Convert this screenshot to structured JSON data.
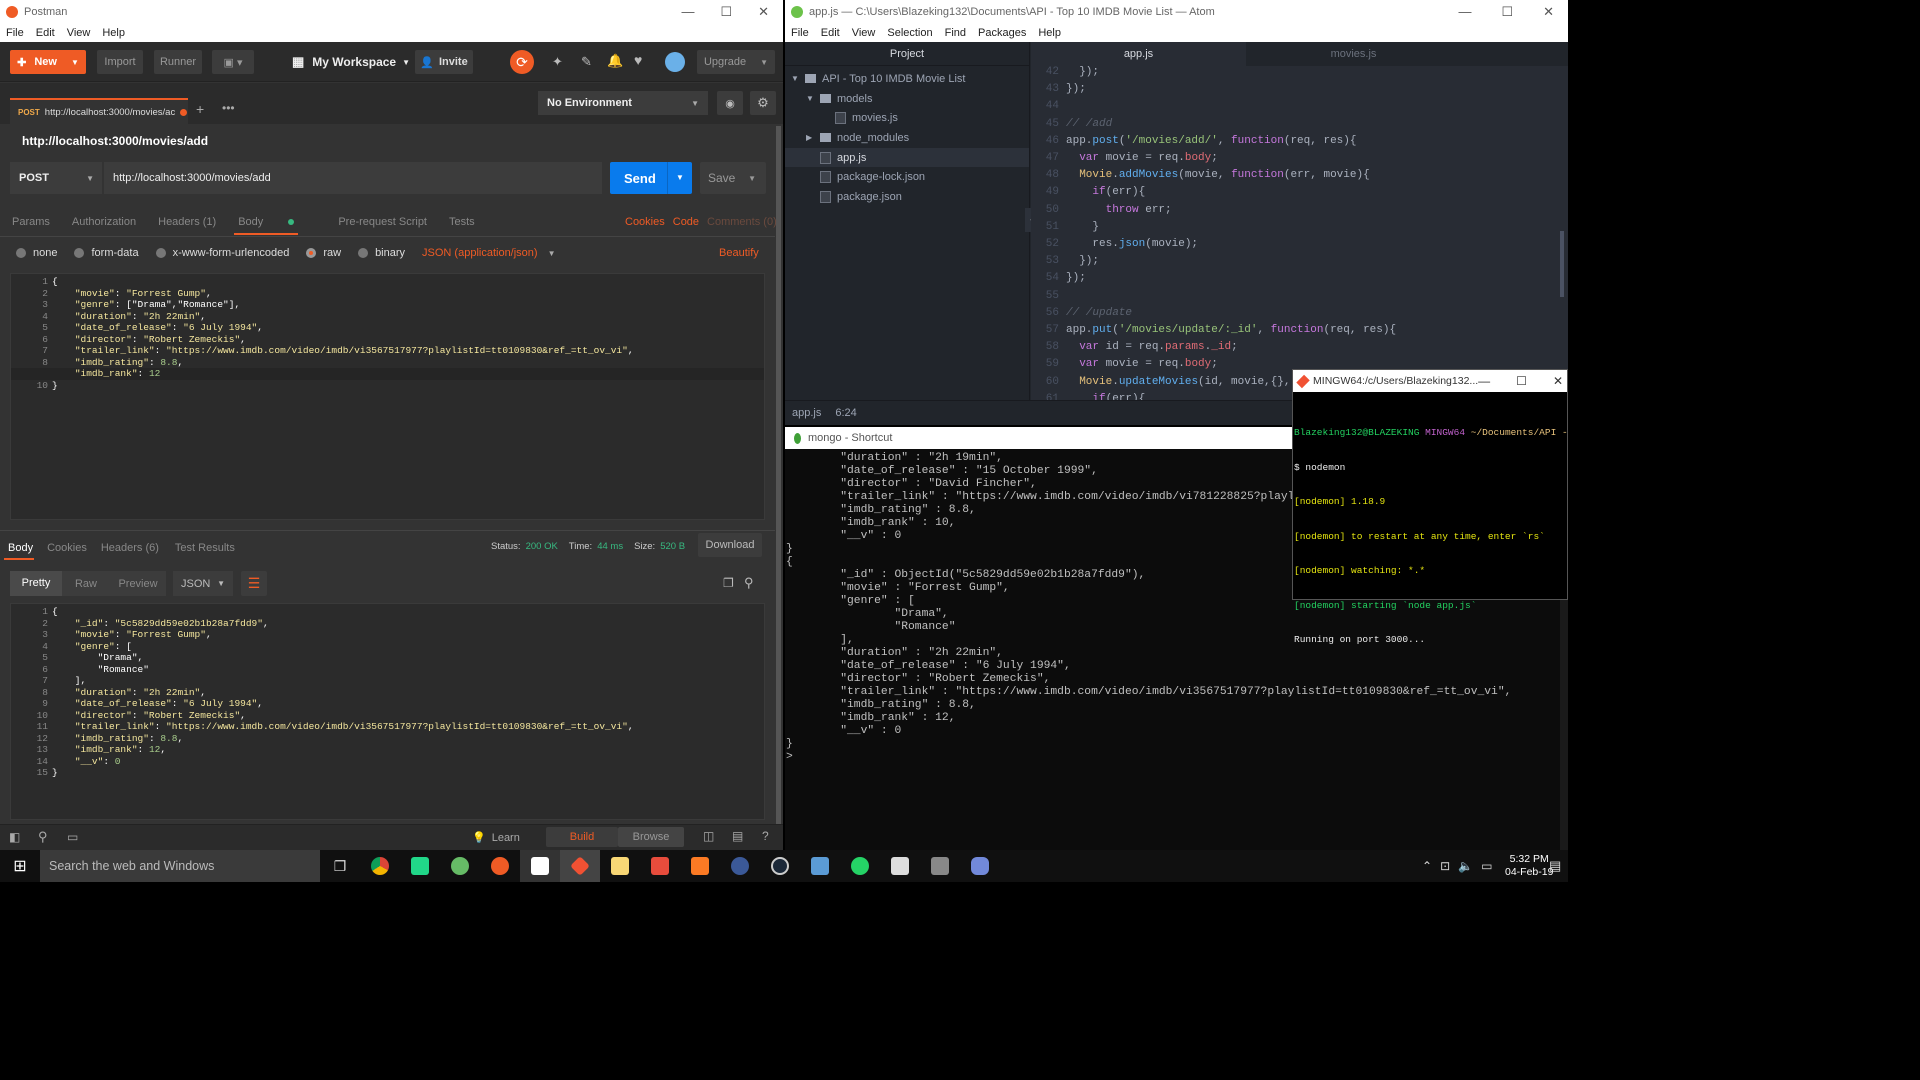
{
  "postman": {
    "title": "Postman",
    "menu": [
      "File",
      "Edit",
      "View",
      "Help"
    ],
    "toolbar": {
      "new": "New",
      "import": "Import",
      "runner": "Runner",
      "workspace": "My Workspace",
      "invite": "Invite",
      "upgrade": "Upgrade"
    },
    "tab": {
      "method": "POST",
      "url": "http://localhost:3000/movies/ac"
    },
    "environment": "No Environment",
    "request_title": "http://localhost:3000/movies/add",
    "method": "POST",
    "url": "http://localhost:3000/movies/add",
    "send": "Send",
    "save": "Save",
    "req_tabs": [
      "Params",
      "Authorization",
      "Headers (1)",
      "Body",
      "Pre-request Script",
      "Tests"
    ],
    "req_links": {
      "cookies": "Cookies",
      "code": "Code",
      "comments": "Comments (0)"
    },
    "body_types": [
      "none",
      "form-data",
      "x-www-form-urlencoded",
      "raw",
      "binary"
    ],
    "content_type": "JSON (application/json)",
    "beautify": "Beautify",
    "request_body": [
      "{",
      "    \"movie\": \"Forrest Gump\",",
      "    \"genre\": [\"Drama\",\"Romance\"],",
      "    \"duration\": \"2h 22min\",",
      "    \"date_of_release\": \"6 July 1994\",",
      "    \"director\": \"Robert Zemeckis\",",
      "    \"trailer_link\": \"https://www.imdb.com/video/imdb/vi3567517977?playlistId=tt0109830&ref_=tt_ov_vi\",",
      "    \"imdb_rating\": 8.8,",
      "    \"imdb_rank\": 12",
      "}"
    ],
    "resp_tabs": [
      "Body",
      "Cookies",
      "Headers (6)",
      "Test Results"
    ],
    "status": {
      "status_label": "Status:",
      "status": "200 OK",
      "time_label": "Time:",
      "time": "44 ms",
      "size_label": "Size:",
      "size": "520 B"
    },
    "download": "Download",
    "view_modes": [
      "Pretty",
      "Raw",
      "Preview"
    ],
    "format": "JSON",
    "response_body": [
      "{",
      "    \"_id\": \"5c5829dd59e02b1b28a7fdd9\",",
      "    \"movie\": \"Forrest Gump\",",
      "    \"genre\": [",
      "        \"Drama\",",
      "        \"Romance\"",
      "    ],",
      "    \"duration\": \"2h 22min\",",
      "    \"date_of_release\": \"6 July 1994\",",
      "    \"director\": \"Robert Zemeckis\",",
      "    \"trailer_link\": \"https://www.imdb.com/video/imdb/vi3567517977?playlistId=tt0109830&ref_=tt_ov_vi\",",
      "    \"imdb_rating\": 8.8,",
      "    \"imdb_rank\": 12,",
      "    \"__v\": 0",
      "}"
    ],
    "footer": {
      "learn": "Learn",
      "build": "Build",
      "browse": "Browse"
    }
  },
  "atom": {
    "title": "app.js — C:\\Users\\Blazeking132\\Documents\\API - Top 10 IMDB Movie List — Atom",
    "menu": [
      "File",
      "Edit",
      "View",
      "Selection",
      "Find",
      "Packages",
      "Help"
    ],
    "project_label": "Project",
    "tabs": [
      "app.js",
      "movies.js"
    ],
    "tree": [
      {
        "label": "API - Top 10 IMDB Movie List",
        "indent": 0,
        "kind": "folder-open"
      },
      {
        "label": "models",
        "indent": 1,
        "kind": "folder-open"
      },
      {
        "label": "movies.js",
        "indent": 2,
        "kind": "file"
      },
      {
        "label": "node_modules",
        "indent": 1,
        "kind": "folder"
      },
      {
        "label": "app.js",
        "indent": 1,
        "kind": "file"
      },
      {
        "label": "package-lock.json",
        "indent": 1,
        "kind": "file"
      },
      {
        "label": "package.json",
        "indent": 1,
        "kind": "file"
      }
    ],
    "line_numbers": [
      "42",
      "43",
      "44",
      "45",
      "46",
      "47",
      "48",
      "49",
      "50",
      "51",
      "52",
      "53",
      "54",
      "55",
      "56",
      "57",
      "58",
      "59",
      "60",
      "61"
    ],
    "status": {
      "file": "app.js",
      "pos": "6:24"
    }
  },
  "mongo": {
    "title": "mongo - Shortcut",
    "lines": [
      "        \"duration\" : \"2h 19min\",",
      "        \"date_of_release\" : \"15 October 1999\",",
      "        \"director\" : \"David Fincher\",",
      "        \"trailer_link\" : \"https://www.imdb.com/video/imdb/vi781228825?playlist",
      "        \"imdb_rating\" : 8.8,",
      "        \"imdb_rank\" : 10,",
      "        \"__v\" : 0",
      "}",
      "{",
      "        \"_id\" : ObjectId(\"5c5829dd59e02b1b28a7fdd9\"),",
      "        \"movie\" : \"Forrest Gump\",",
      "        \"genre\" : [",
      "                \"Drama\",",
      "                \"Romance\"",
      "        ],",
      "        \"duration\" : \"2h 22min\",",
      "        \"date_of_release\" : \"6 July 1994\",",
      "        \"director\" : \"Robert Zemeckis\",",
      "        \"trailer_link\" : \"https://www.imdb.com/video/imdb/vi3567517977?playlistId=tt0109830&ref_=tt_ov_vi\",",
      "        \"imdb_rating\" : 8.8,",
      "        \"imdb_rank\" : 12,",
      "        \"__v\" : 0",
      "}",
      ">"
    ]
  },
  "mingw": {
    "title": "MINGW64:/c/Users/Blazeking132...",
    "prompt_user": "Blazeking132@BLAZEKING",
    "prompt_env": "MINGW64",
    "prompt_path": "~/Documents/API -",
    "command": "$ nodemon",
    "lines": [
      "[nodemon] 1.18.9",
      "[nodemon] to restart at any time, enter `rs`",
      "[nodemon] watching: *.*",
      "[nodemon] starting `node app.js`"
    ],
    "output": "Running on port 3000..."
  },
  "taskbar": {
    "search": "Search the web and Windows",
    "time": "5:32 PM",
    "date": "04-Feb-19"
  }
}
